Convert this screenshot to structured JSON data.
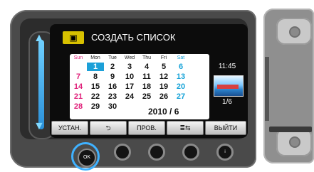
{
  "screen": {
    "title": "СОЗДАТЬ СПИСОК",
    "title_icon": "movie-camera-icon"
  },
  "calendar": {
    "weekdays": [
      "Sun",
      "Mon",
      "Tue",
      "Wed",
      "Thu",
      "Fri",
      "Sat"
    ],
    "weeks": [
      [
        "",
        "1",
        "2",
        "3",
        "4",
        "5",
        "6"
      ],
      [
        "7",
        "8",
        "9",
        "10",
        "11",
        "12",
        "13"
      ],
      [
        "14",
        "15",
        "16",
        "17",
        "18",
        "19",
        "20"
      ],
      [
        "21",
        "22",
        "23",
        "24",
        "25",
        "26",
        "27"
      ],
      [
        "28",
        "29",
        "30",
        "",
        "",
        "",
        ""
      ]
    ],
    "selected_day": "1",
    "month_year": "2010 / 6",
    "colors": {
      "sun": "#e0207a",
      "sat": "#17a3d8",
      "selected": "#1ca0d8"
    }
  },
  "preview": {
    "time": "11:45",
    "page": "1/6"
  },
  "buttons": {
    "set": "УСТАН.",
    "back": "⮌",
    "view": "ПРОВ.",
    "layout": "≣⇆",
    "exit": "ВЫЙТИ"
  },
  "physical_buttons": {
    "ok_label": "OK",
    "info_label": "i"
  }
}
